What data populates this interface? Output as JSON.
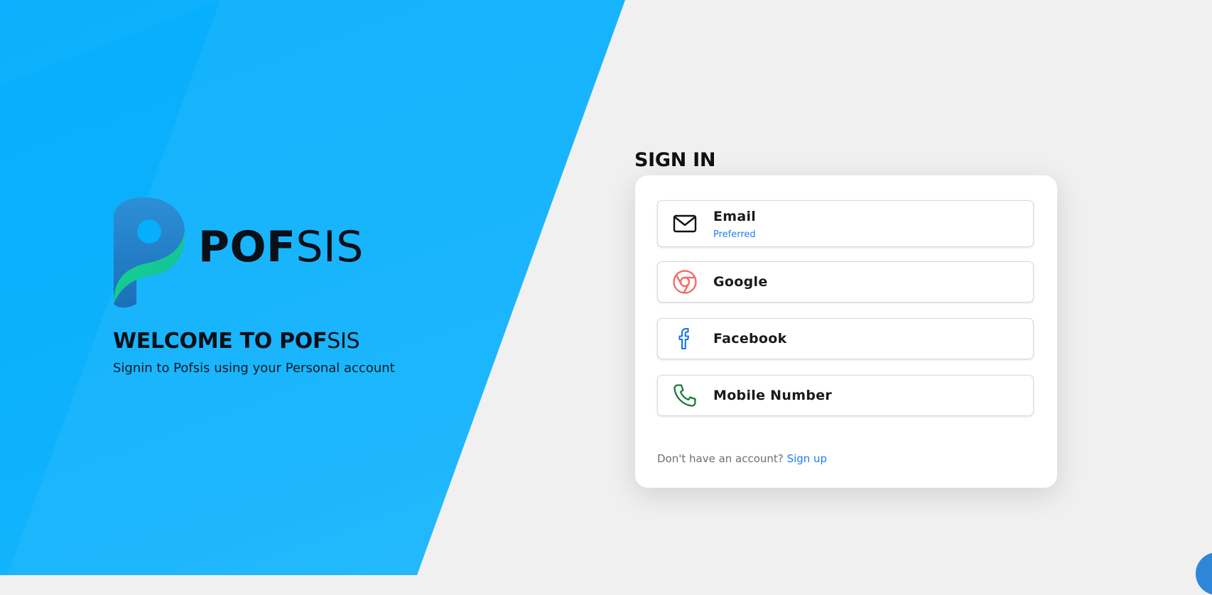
{
  "brand": {
    "bold": "POF",
    "light": "SIS"
  },
  "welcome": {
    "bold": "WELCOME TO POF",
    "light": "SIS"
  },
  "subtitle": "Signin to Pofsis using your Personal account",
  "signin": {
    "title": "SIGN IN",
    "options": [
      {
        "label": "Email",
        "sub": "Preferred",
        "icon": "mail-icon"
      },
      {
        "label": "Google",
        "icon": "chrome-icon"
      },
      {
        "label": "Facebook",
        "icon": "facebook-icon"
      },
      {
        "label": "Mobile Number",
        "icon": "phone-icon"
      }
    ],
    "footer_text": "Don't have an account?",
    "signup_link": "Sign up"
  },
  "colors": {
    "hero_blue": "#06aefc",
    "link_blue": "#1d7ff0",
    "google_red": "#f26d6d",
    "facebook_blue": "#1b74e4",
    "phone_green": "#1c7a3c"
  }
}
